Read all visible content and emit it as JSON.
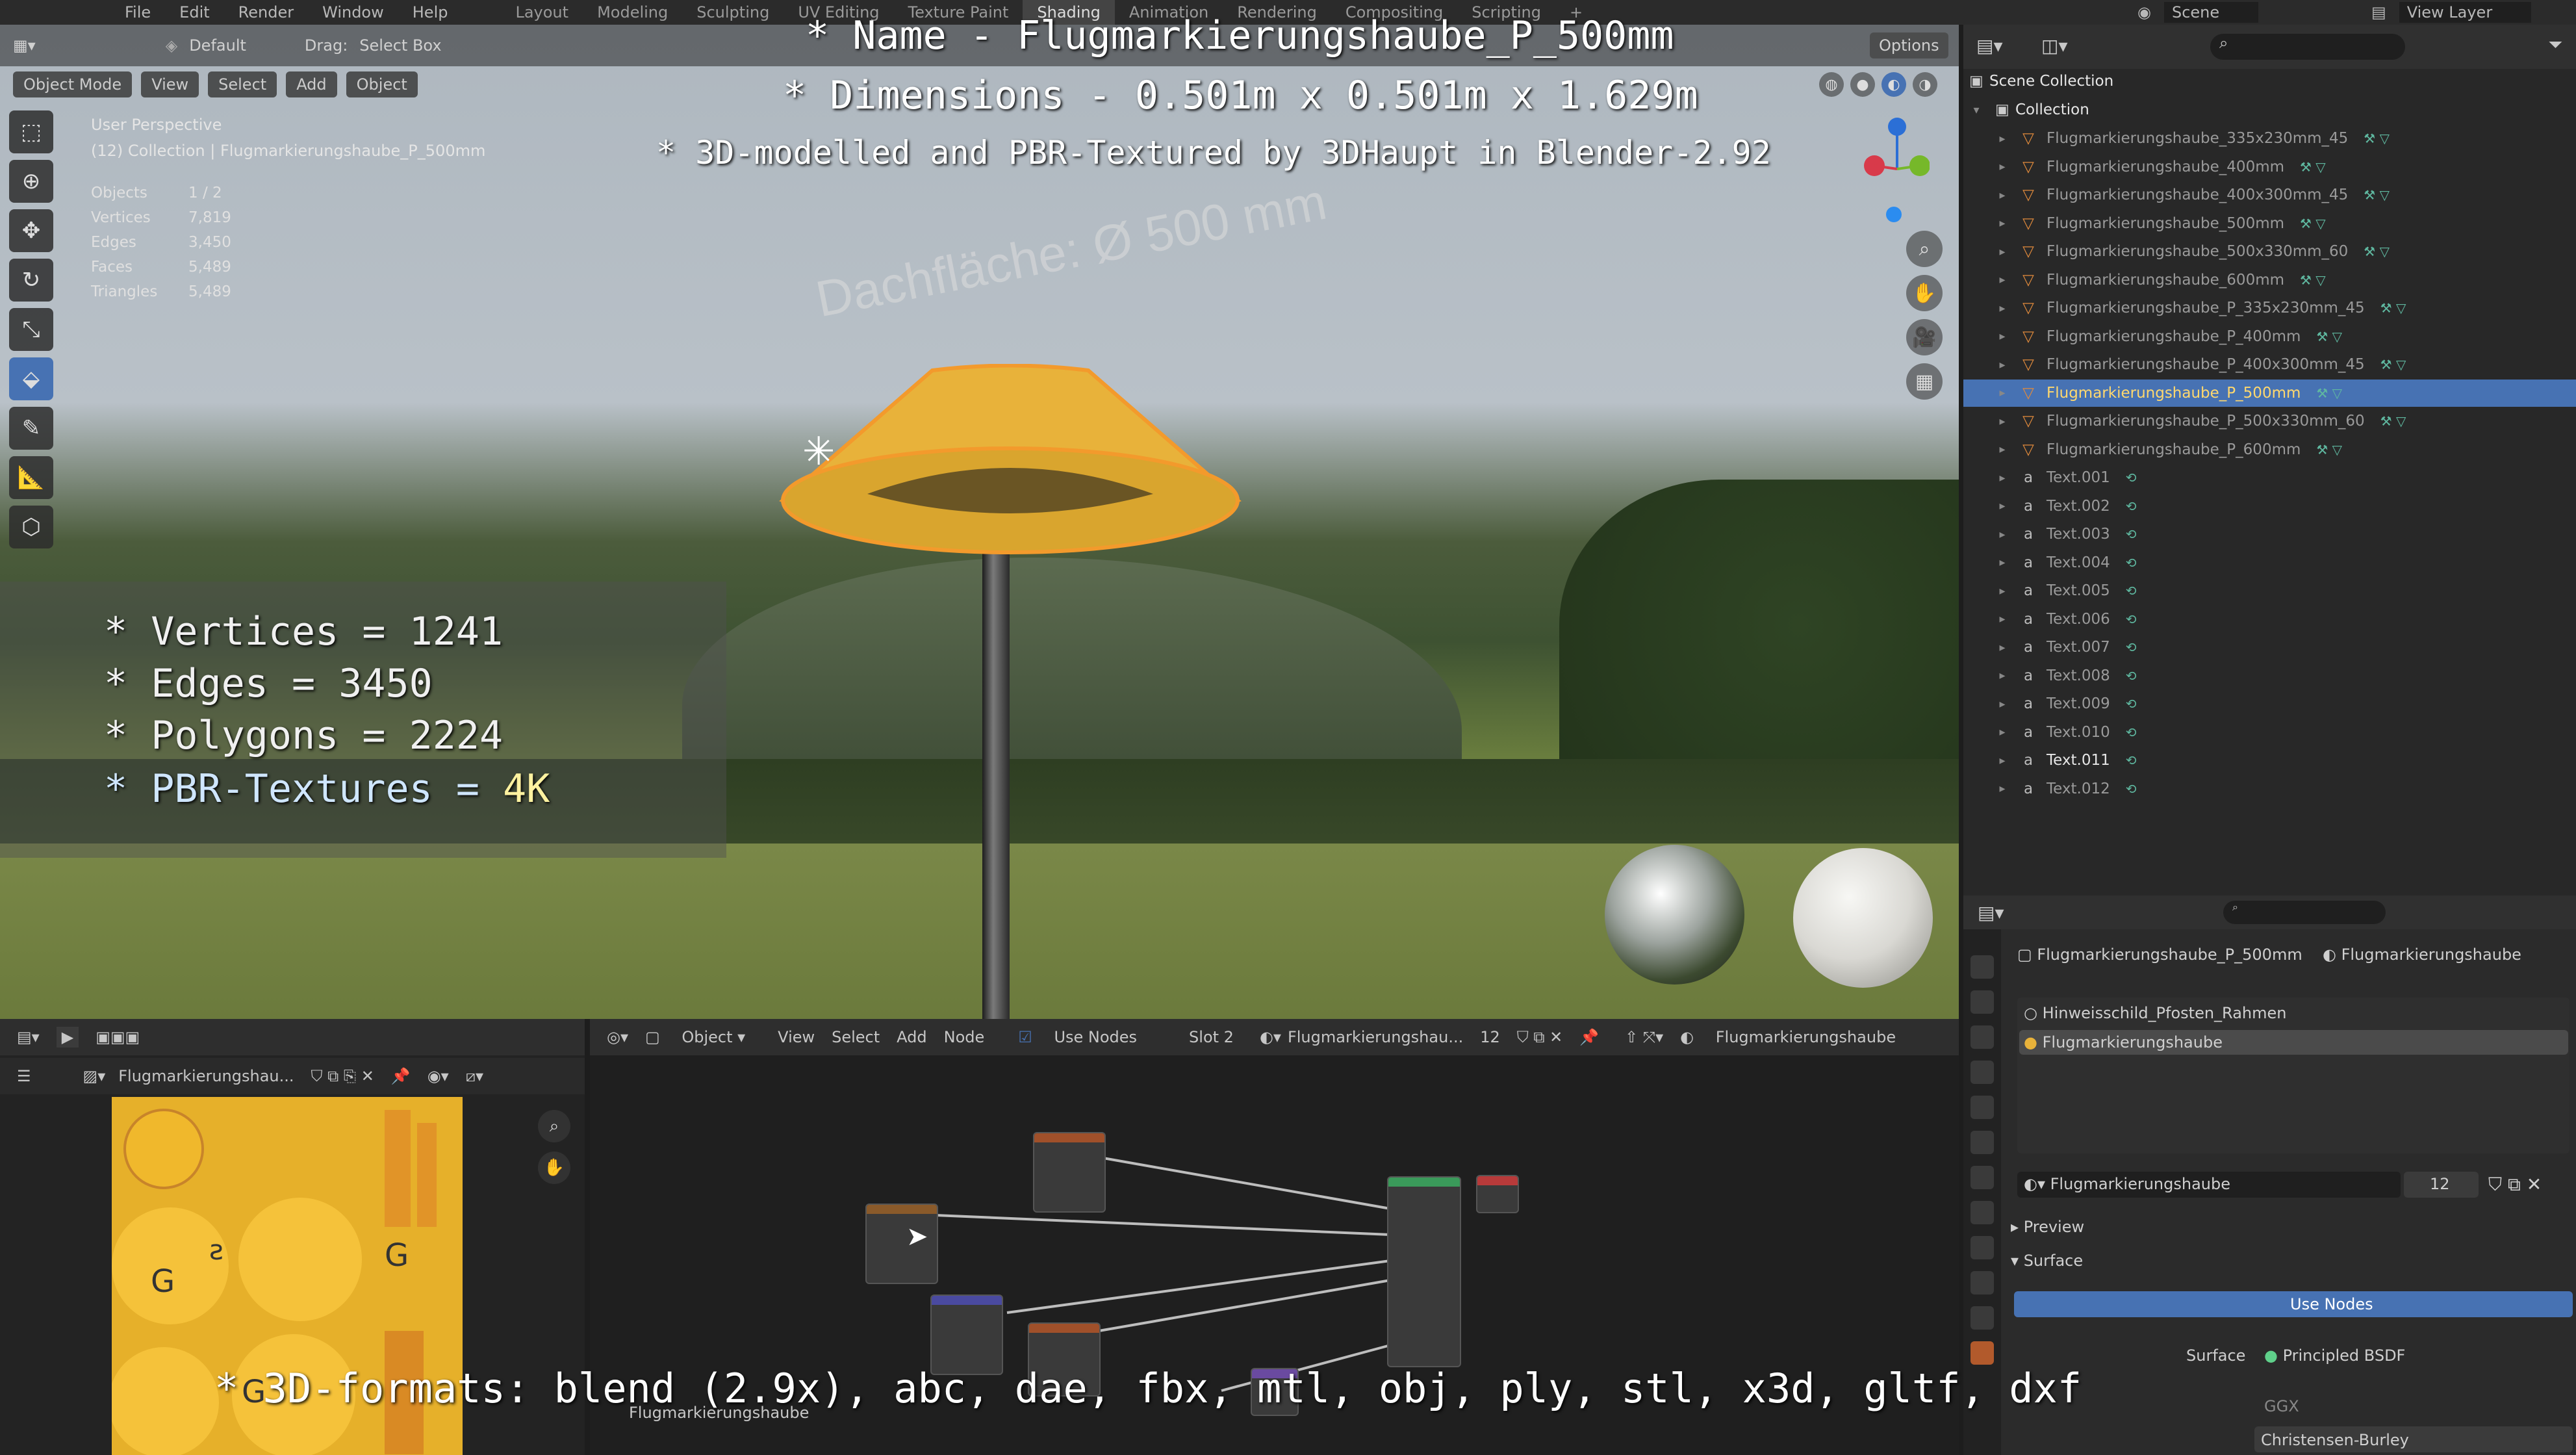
{
  "topbar": {
    "menus": [
      "File",
      "Edit",
      "Render",
      "Window",
      "Help"
    ],
    "workspaces": [
      "Layout",
      "Modeling",
      "Sculpting",
      "UV Editing",
      "Texture Paint",
      "Shading",
      "Animation",
      "Rendering",
      "Compositing",
      "Scripting"
    ],
    "active_workspace": "Shading",
    "scene": "Scene",
    "view_layer": "View Layer"
  },
  "viewport": {
    "orientation": "Default",
    "drag_label": "Drag:",
    "drag_value": "Select Box",
    "options": "Options",
    "mode": "Object Mode",
    "menus": [
      "View",
      "Select",
      "Add",
      "Object"
    ],
    "perspective": "User Perspective",
    "collection_path": "(12) Collection | Flugmarkierungshaube_P_500mm",
    "stats": [
      {
        "k": "Objects",
        "v": "1 / 2"
      },
      {
        "k": "Vertices",
        "v": "7,819"
      },
      {
        "k": "Edges",
        "v": "3,450"
      },
      {
        "k": "Faces",
        "v": "5,489"
      },
      {
        "k": "Triangles",
        "v": "5,489"
      }
    ],
    "scene_text": "Dachfläche:  Ø 500 mm"
  },
  "overlay": {
    "name_line": "* Name - Flugmarkierungshaube_P_500mm",
    "dim_line": "* Dimensions -  0.501m x 0.501m x 1.629m",
    "credit_line": "* 3D-modelled and PBR-Textured by 3DHaupt in Blender-2.92",
    "spec_lines": [
      "* Vertices = 1241",
      "* Edges = 3450",
      "* Polygons = 2224"
    ],
    "pbr_label": "* PBR-Textures = ",
    "pbr_value": "4K",
    "formats_line": "* 3D-formats: blend (2.9x), abc, dae, fbx, mtl, obj, ply, stl, x3d, gltf, dxf"
  },
  "outliner": {
    "scene_collection": "Scene Collection",
    "collection": "Collection",
    "items": [
      "Flugmarkierungshaube_335x230mm_45",
      "Flugmarkierungshaube_400mm",
      "Flugmarkierungshaube_400x300mm_45",
      "Flugmarkierungshaube_500mm",
      "Flugmarkierungshaube_500x330mm_60",
      "Flugmarkierungshaube_600mm",
      "Flugmarkierungshaube_P_335x230mm_45",
      "Flugmarkierungshaube_P_400mm",
      "Flugmarkierungshaube_P_400x300mm_45",
      "Flugmarkierungshaube_P_500mm",
      "Flugmarkierungshaube_P_500x330mm_60",
      "Flugmarkierungshaube_P_600mm",
      "Text.001",
      "Text.002",
      "Text.003",
      "Text.004",
      "Text.005",
      "Text.006",
      "Text.007",
      "Text.008",
      "Text.009",
      "Text.010",
      "Text.011",
      "Text.012"
    ],
    "selected": "Flugmarkierungshaube_P_500mm",
    "bright": "Text.011"
  },
  "properties": {
    "object_name": "Flugmarkierungshaube_P_500mm",
    "material_name": "Flugmarkierungshaube",
    "slots": [
      "Hinweisschild_Pfosten_Rahmen",
      "Flugmarkierungshaube"
    ],
    "users": "12",
    "preview": "Preview",
    "surface": "Surface",
    "use_nodes": "Use Nodes",
    "surface_label": "Surface",
    "surface_value": "Principled BSDF",
    "ggx": "GGX",
    "subsurface": "Christensen-Burley"
  },
  "image_editor": {
    "image_name": "Flugmarkierungshau..."
  },
  "node_editor": {
    "type": "Object",
    "menus": [
      "View",
      "Select",
      "Add",
      "Node"
    ],
    "use_nodes": "Use Nodes",
    "slot": "Slot 2",
    "material": "Flugmarkierungshau...",
    "users": "12",
    "material_right": "Flugmarkierungshaube",
    "footer_label": "Flugmarkierungshaube"
  },
  "colors": {
    "accent": "#4772b3",
    "lamp": "#e8b23a",
    "texture": "#e6b02a"
  }
}
